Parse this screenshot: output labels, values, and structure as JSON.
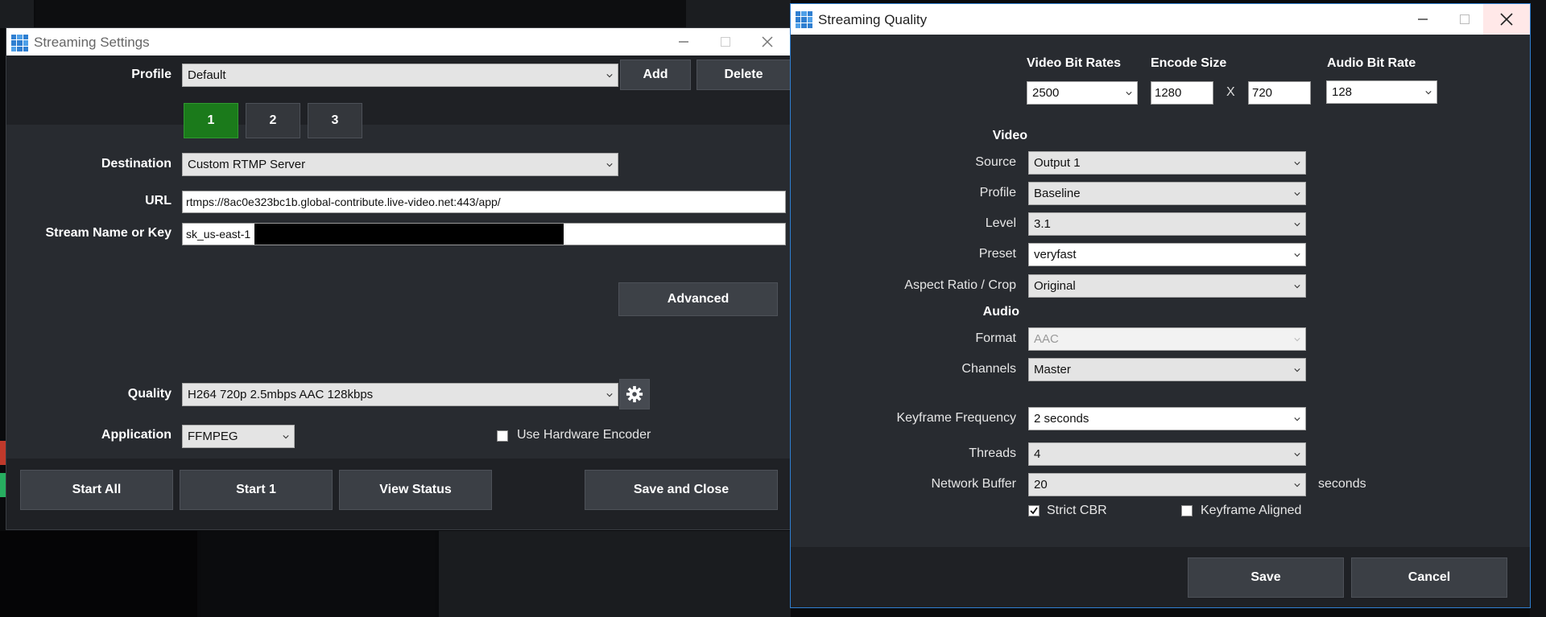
{
  "settings": {
    "title": "Streaming Settings",
    "profile": {
      "label": "Profile",
      "value": "Default",
      "add_label": "Add",
      "delete_label": "Delete"
    },
    "tabs": [
      "1",
      "2",
      "3"
    ],
    "active_tab": "1",
    "destination": {
      "label": "Destination",
      "value": "Custom RTMP Server"
    },
    "url": {
      "label": "URL",
      "value": "rtmps://8ac0e323bc1b.global-contribute.live-video.net:443/app/"
    },
    "stream_key": {
      "label": "Stream Name or Key",
      "value": "sk_us-east-1"
    },
    "advanced_label": "Advanced",
    "quality": {
      "label": "Quality",
      "value": "H264 720p 2.5mbps AAC 128kbps",
      "settings_icon": "gear-icon"
    },
    "application": {
      "label": "Application",
      "value": "FFMPEG"
    },
    "hardware_encoder": {
      "label": "Use Hardware Encoder",
      "checked": false
    },
    "buttons": {
      "start_all": "Start All",
      "start_1": "Start 1",
      "view_status": "View Status",
      "save_close": "Save and Close"
    }
  },
  "quality": {
    "title": "Streaming Quality",
    "video_bit_rates": {
      "label": "Video Bit Rates",
      "value": "2500"
    },
    "encode_size": {
      "label": "Encode Size",
      "width": "1280",
      "sep": "X",
      "height": "720"
    },
    "audio_bit_rate": {
      "label": "Audio Bit Rate",
      "value": "128"
    },
    "video_header": "Video",
    "source": {
      "label": "Source",
      "value": "Output 1"
    },
    "profile": {
      "label": "Profile",
      "value": "Baseline"
    },
    "level": {
      "label": "Level",
      "value": "3.1"
    },
    "preset": {
      "label": "Preset",
      "value": "veryfast"
    },
    "aspect": {
      "label": "Aspect Ratio / Crop",
      "value": "Original"
    },
    "audio_header": "Audio",
    "format": {
      "label": "Format",
      "value": "AAC"
    },
    "channels": {
      "label": "Channels",
      "value": "Master"
    },
    "keyframe": {
      "label": "Keyframe Frequency",
      "value": "2 seconds"
    },
    "threads": {
      "label": "Threads",
      "value": "4"
    },
    "network_buffer": {
      "label": "Network Buffer",
      "value": "20",
      "unit": "seconds"
    },
    "strict_cbr": {
      "label": "Strict CBR",
      "checked": true
    },
    "keyframe_aligned": {
      "label": "Keyframe Aligned",
      "checked": false
    },
    "save_label": "Save",
    "cancel_label": "Cancel"
  },
  "colors": {
    "window_bg": "#282b30",
    "button_bg": "#3b3f45",
    "active_tab": "#1b7a1b",
    "titlebar": "#ffffff"
  }
}
